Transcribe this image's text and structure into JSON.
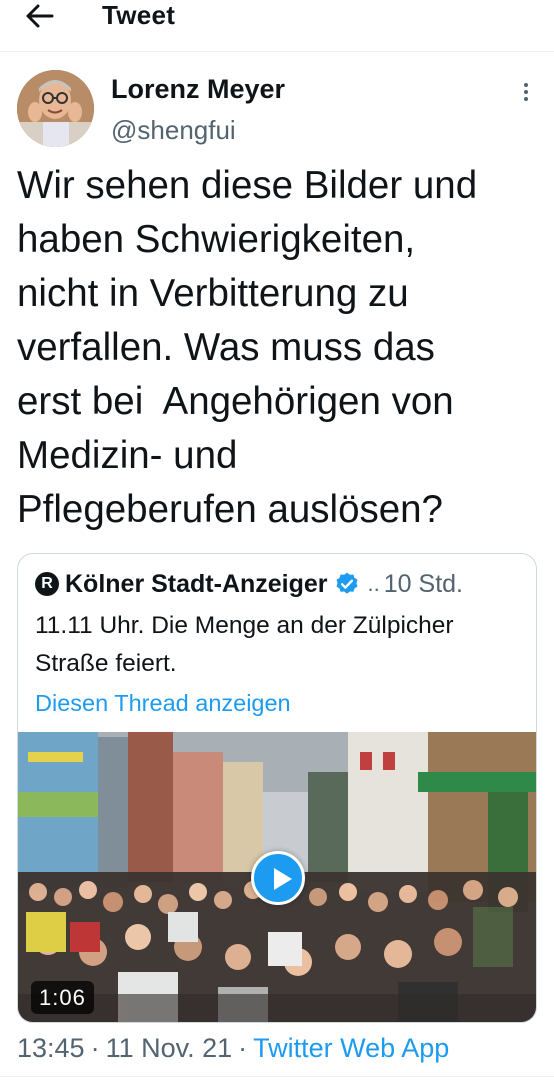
{
  "header": {
    "title": "Tweet",
    "back_icon": "arrow-left-icon"
  },
  "tweet": {
    "author_name": "Lorenz Meyer",
    "author_handle": "@shengfui",
    "text": "Wir sehen diese Bilder und\nhaben Schwierigkeiten,\nnicht in Verbitterung zu\nverfallen. Was muss das\nerst bei  Angehörigen von\nMedizin- und\nPflegeberufen auslösen?",
    "time": "13:45",
    "date": "11 Nov. 21",
    "source": "Twitter Web App"
  },
  "quote": {
    "logo_letter": "R",
    "author_name": "Kölner Stadt-Anzeiger",
    "dots": "..",
    "time": "10 Std.",
    "text": "11.11 Uhr. Die Menge an der Zülpicher Straße feiert.",
    "thread_link": "Diesen Thread anzeigen",
    "video_duration": "1:06"
  },
  "colors": {
    "accent": "#1d9bf0",
    "text": "#0f1419",
    "secondary": "#536471",
    "border": "#cfd9de"
  }
}
